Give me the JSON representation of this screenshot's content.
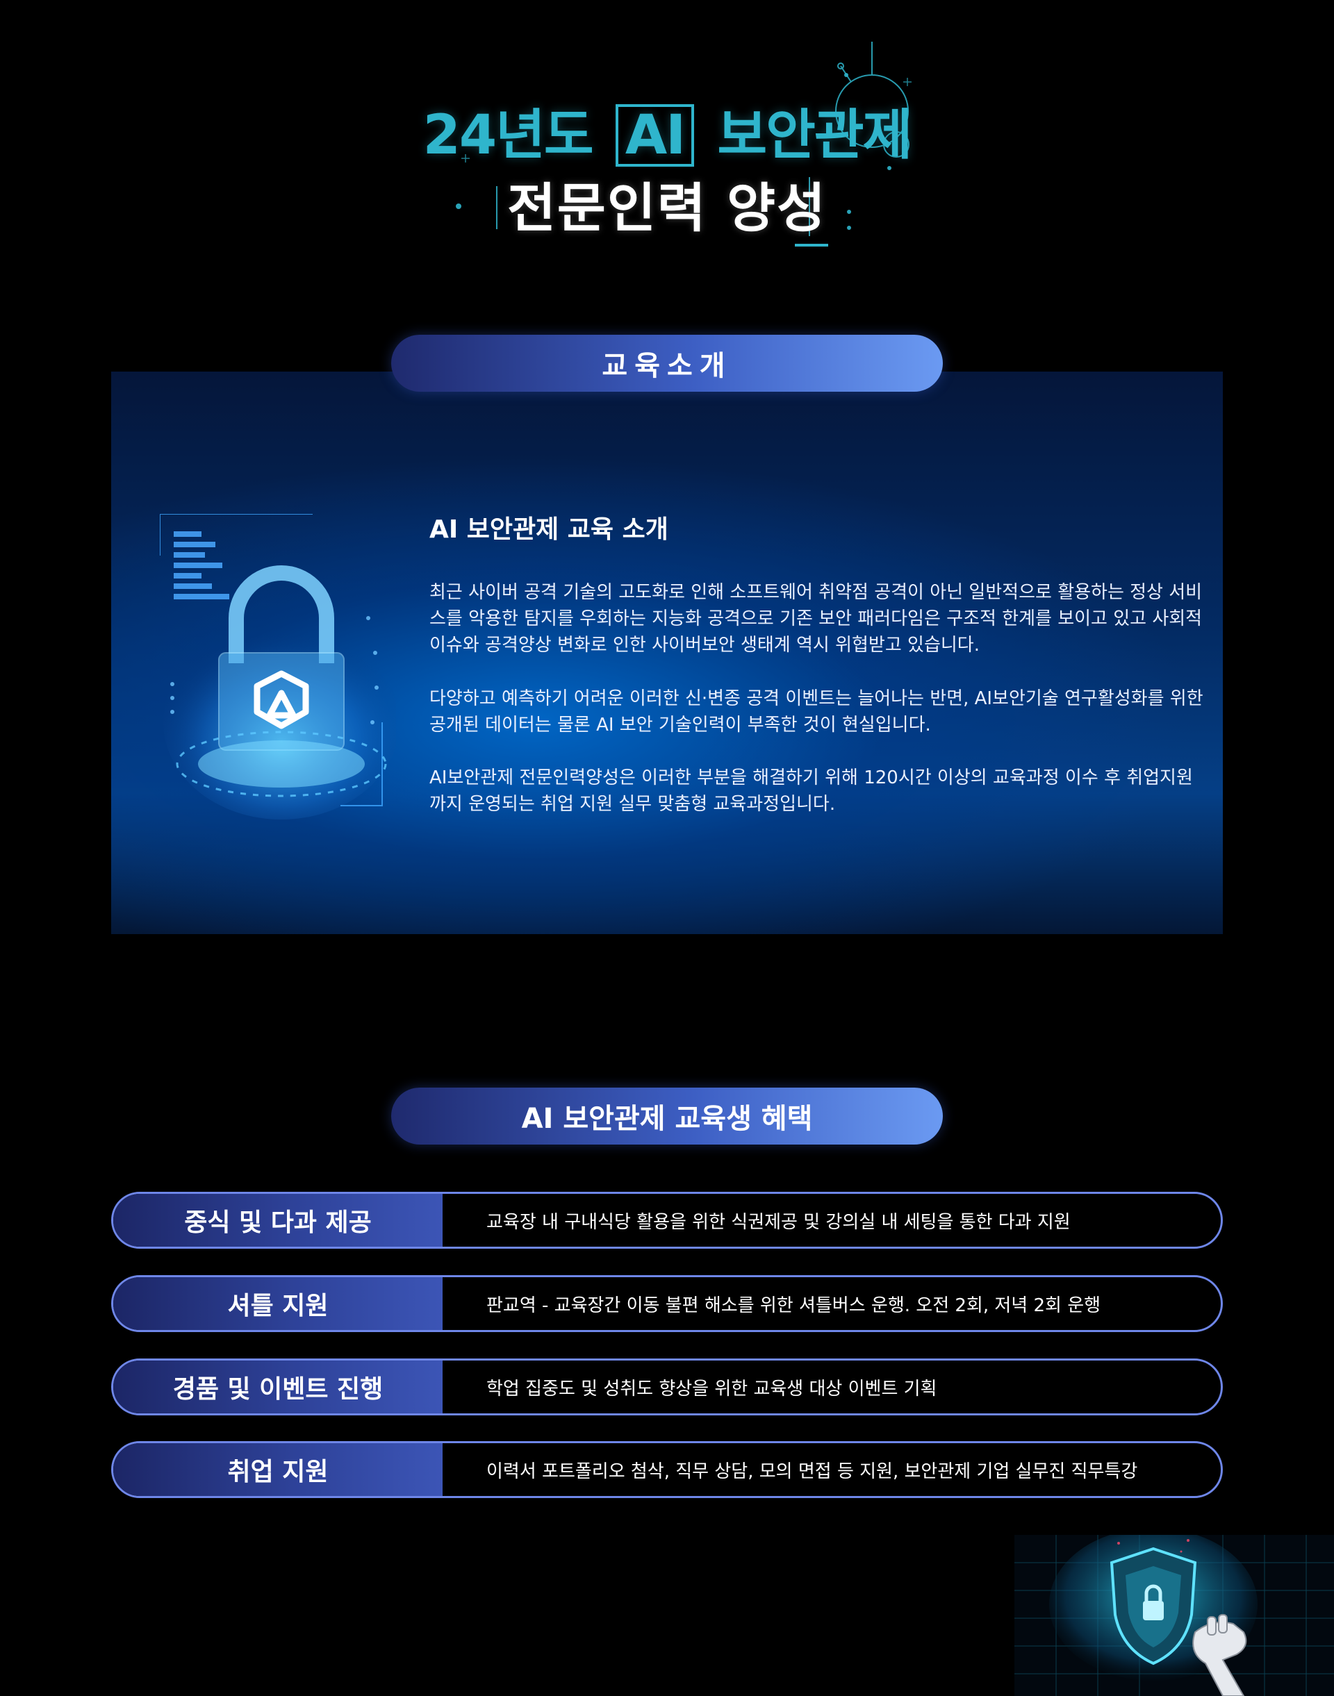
{
  "hero": {
    "line1_prefix": "24년도",
    "line1_ai": "AI",
    "line1_suffix": "보안관제",
    "line2": "전문인력 양성"
  },
  "intro": {
    "header": "교육소개",
    "title": "AI 보안관제 교육 소개",
    "paragraphs": [
      "최근 사이버 공격 기술의 고도화로 인해 소프트웨어 취약점 공격이 아닌 일반적으로 활용하는 정상 서비스를 악용한 탐지를 우회하는 지능화 공격으로 기존 보안 패러다임은 구조적 한계를 보이고 있고 사회적 이슈와 공격양상 변화로 인한 사이버보안 생태계 역시 위협받고 있습니다.",
      "다양하고 예측하기 어려운 이러한 신·변종 공격 이벤트는 늘어나는 반면, AI보안기술 연구활성화를 위한 공개된 데이터는 물론 AI 보안 기술인력이 부족한 것이 현실입니다.",
      "AI보안관제 전문인력양성은 이러한 부분을 해결하기 위해 120시간 이상의 교육과정 이수 후 취업지원까지 운영되는 취업 지원 실무 맞춤형 교육과정입니다."
    ]
  },
  "benefits": {
    "header": "AI 보안관제 교육생 혜택",
    "items": [
      {
        "label": "중식 및 다과 제공",
        "desc": "교육장 내 구내식당 활용을 위한 식권제공 및 강의실 내 세팅을 통한 다과 지원"
      },
      {
        "label": "셔틀 지원",
        "desc": "판교역 - 교육장간 이동 불편 해소를 위한 셔틀버스 운행. 오전 2회, 저녁 2회 운행"
      },
      {
        "label": "경품 및 이벤트 진행",
        "desc": "학업 집중도 및 성취도 향상을 위한 교육생 대상 이벤트 기획"
      },
      {
        "label": "취업 지원",
        "desc": "이력서 포트폴리오 첨삭, 직무 상담, 모의 면접 등 지원, 보안관제 기업 실무진 직무특강"
      }
    ]
  },
  "colors": {
    "accent_cyan": "#2fb5cc",
    "pill_gradient_start": "#1f2a6e",
    "pill_gradient_end": "#6b9af2",
    "row_border": "#6e86e8",
    "background": "#000000"
  },
  "icons": [
    "circuit-decoration-icon",
    "lock-shield-icon",
    "ai-shield-robot-hand-icon"
  ]
}
